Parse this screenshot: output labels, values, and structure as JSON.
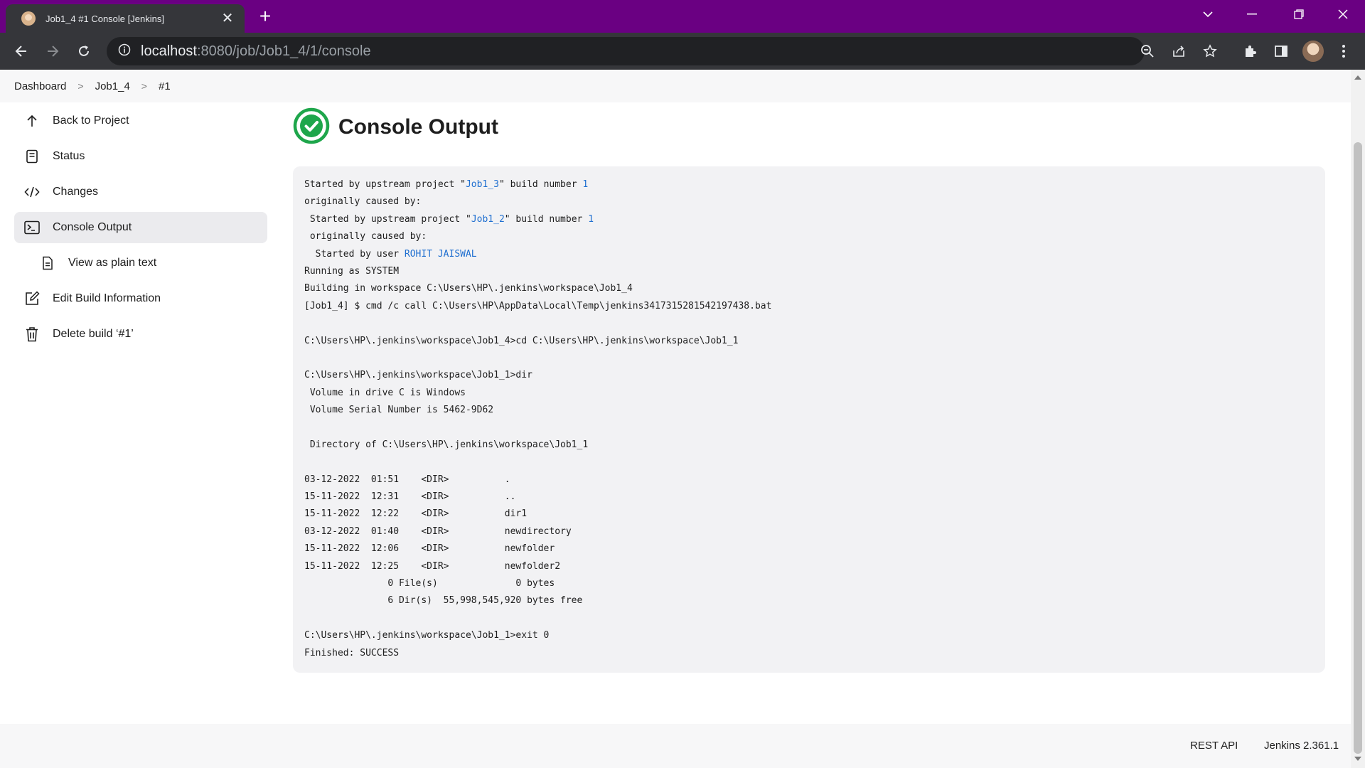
{
  "browser": {
    "tab_title": "Job1_4 #1 Console [Jenkins]",
    "url_host": "localhost",
    "url_path": ":8080/job/Job1_4/1/console"
  },
  "breadcrumb": [
    "Dashboard",
    "Job1_4",
    "#1"
  ],
  "sidebar": {
    "items": [
      {
        "label": "Back to Project",
        "icon": "arrow-up-icon"
      },
      {
        "label": "Status",
        "icon": "document-icon"
      },
      {
        "label": "Changes",
        "icon": "code-icon"
      },
      {
        "label": "Console Output",
        "icon": "terminal-icon",
        "active": true
      },
      {
        "label": "View as plain text",
        "icon": "file-icon"
      },
      {
        "label": "Edit Build Information",
        "icon": "edit-icon"
      },
      {
        "label": "Delete build ‘#1’",
        "icon": "trash-icon"
      }
    ]
  },
  "main": {
    "title": "Console Output",
    "status_icon": "success-check-icon",
    "status_color": "#1ea64b"
  },
  "console": {
    "l1_a": "Started by upstream project \"",
    "l1_link": "Job1_3",
    "l1_b": "\" build number ",
    "l1_num": "1",
    "l2": "originally caused by:",
    "l3_a": " Started by upstream project \"",
    "l3_link": "Job1_2",
    "l3_b": "\" build number ",
    "l3_num": "1",
    "l4": " originally caused by:",
    "l5_a": "  Started by user ",
    "l5_link": "ROHIT JAISWAL",
    "l6": "Running as SYSTEM",
    "l7": "Building in workspace C:\\Users\\HP\\.jenkins\\workspace\\Job1_4",
    "l8": "[Job1_4] $ cmd /c call C:\\Users\\HP\\AppData\\Local\\Temp\\jenkins3417315281542197438.bat",
    "l9": "",
    "l10": "C:\\Users\\HP\\.jenkins\\workspace\\Job1_4>cd C:\\Users\\HP\\.jenkins\\workspace\\Job1_1",
    "l11": "",
    "l12": "C:\\Users\\HP\\.jenkins\\workspace\\Job1_1>dir",
    "l13": " Volume in drive C is Windows",
    "l14": " Volume Serial Number is 5462-9D62",
    "l15": "",
    "l16": " Directory of C:\\Users\\HP\\.jenkins\\workspace\\Job1_1",
    "l17": "",
    "l18": "03-12-2022  01:51    <DIR>          .",
    "l19": "15-11-2022  12:31    <DIR>          ..",
    "l20": "15-11-2022  12:22    <DIR>          dir1",
    "l21": "03-12-2022  01:40    <DIR>          newdirectory",
    "l22": "15-11-2022  12:06    <DIR>          newfolder",
    "l23": "15-11-2022  12:25    <DIR>          newfolder2",
    "l24": "               0 File(s)              0 bytes",
    "l25": "               6 Dir(s)  55,998,545,920 bytes free",
    "l26": "",
    "l27": "C:\\Users\\HP\\.jenkins\\workspace\\Job1_1>exit 0",
    "l28": "Finished: SUCCESS"
  },
  "footer": {
    "rest_api": "REST API",
    "version": "Jenkins 2.361.1"
  },
  "colors": {
    "titlebar": "#6a0082",
    "chrome": "#35363a",
    "link": "#1f6fd0",
    "success": "#1ea64b"
  }
}
